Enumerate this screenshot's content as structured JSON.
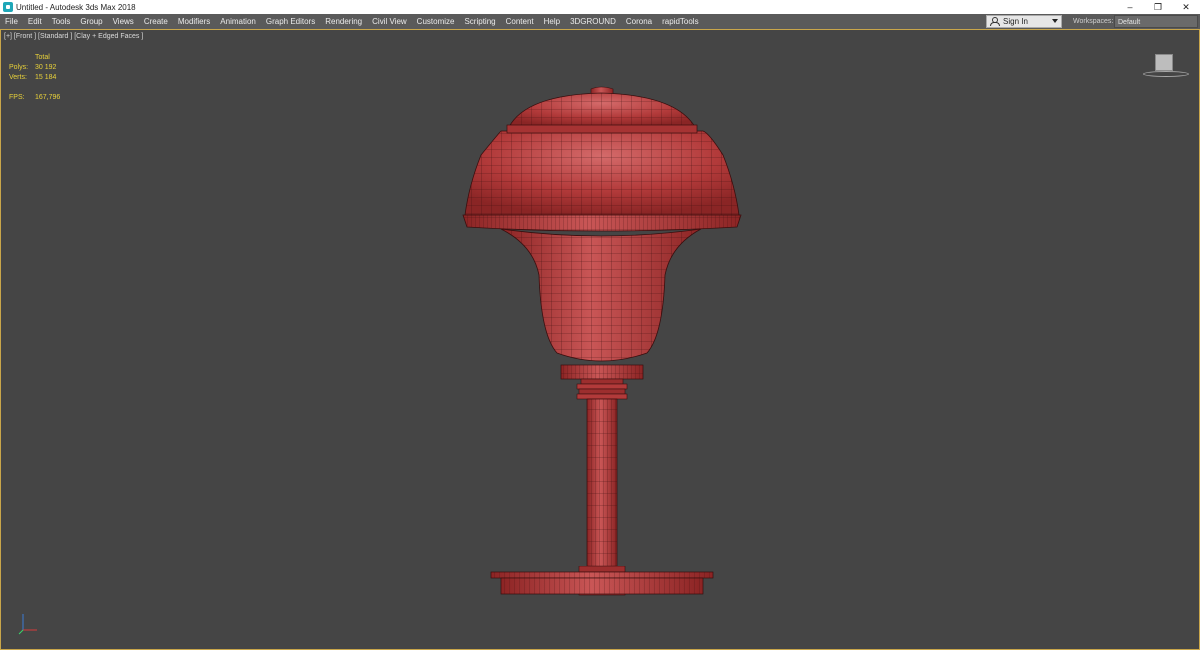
{
  "window": {
    "title": "Untitled - Autodesk 3ds Max 2018",
    "controls": [
      "–",
      "❐",
      "✕"
    ]
  },
  "menu": {
    "items": [
      "File",
      "Edit",
      "Tools",
      "Group",
      "Views",
      "Create",
      "Modifiers",
      "Animation",
      "Graph Editors",
      "Rendering",
      "Civil View",
      "Customize",
      "Scripting",
      "Content",
      "Help",
      "3DGROUND",
      "Corona",
      "rapidTools"
    ],
    "signin_label": "Sign In",
    "workspaces_label": "Workspaces:",
    "workspace_value": "Default"
  },
  "viewport": {
    "label": "[+] [Front ] [Standard ] [Clay + Edged Faces ]",
    "stats": {
      "header": "Total",
      "rows": [
        {
          "key": "Polys:",
          "value": "30 192"
        },
        {
          "key": "Verts:",
          "value": "15 184"
        }
      ],
      "fps_key": "FPS:",
      "fps_value": "167,796"
    }
  },
  "colors": {
    "viewport_bg": "#454545",
    "menubar_bg": "#5a5a5a",
    "stats_text": "#e9d23a",
    "clay": "#b23a3a",
    "wire": "#3a0e0e"
  },
  "icons": {
    "app": "3ds-max-icon",
    "user": "user-icon",
    "viewcube": "viewcube-icon",
    "axis": "axis-tripod-icon"
  }
}
